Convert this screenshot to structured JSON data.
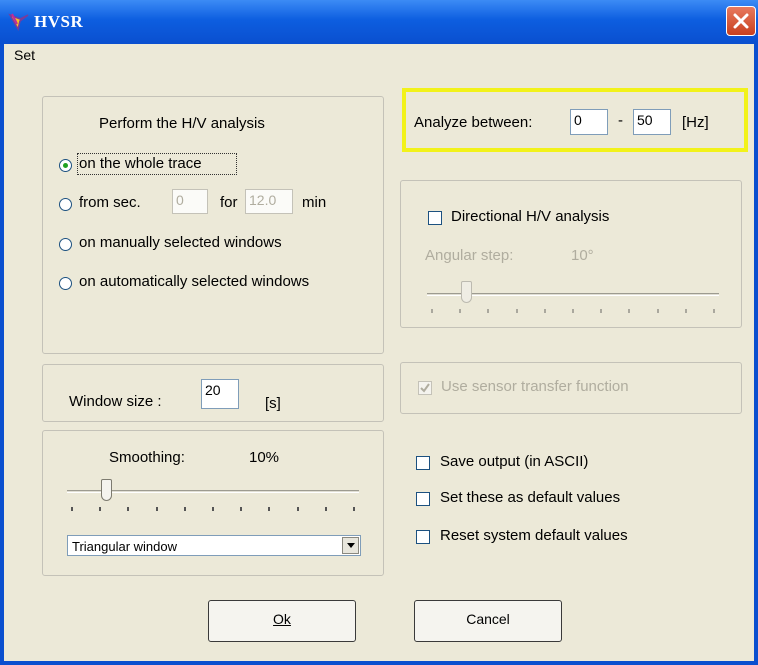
{
  "window": {
    "title": "HVSR",
    "menu": [
      "Set"
    ],
    "icon": "hvsr-logo-icon"
  },
  "analysis": {
    "title": "Perform the H/V analysis",
    "options": [
      {
        "label": "on the whole trace",
        "selected": true
      },
      {
        "label_before": "from sec.",
        "from_value": "0",
        "label_mid": "for",
        "for_value": "12.0",
        "label_after": "min",
        "selected": false
      },
      {
        "label": "on manually selected windows",
        "selected": false
      },
      {
        "label": "on automatically selected windows",
        "selected": false
      }
    ]
  },
  "range": {
    "label": "Analyze between:",
    "from": "0",
    "separator": "-",
    "to": "50",
    "unit": "[Hz]",
    "highlight_color": "#f2f21a"
  },
  "directional": {
    "checkbox_label": "Directional H/V analysis",
    "checked": false,
    "angular_label": "Angular step:",
    "angular_value": "10°",
    "slider_position": 0.12
  },
  "window_size": {
    "label": "Window size :",
    "value": "20",
    "unit": "[s]"
  },
  "sensor": {
    "label": "Use sensor transfer function",
    "checked": true,
    "enabled": false
  },
  "smoothing": {
    "label": "Smoothing:",
    "value": "10%",
    "slider_position": 0.12,
    "window_type": "Triangular window"
  },
  "options": [
    {
      "label": "Save output (in ASCII)",
      "checked": false
    },
    {
      "label": "Set these as default values",
      "checked": false
    },
    {
      "label": "Reset system default values",
      "checked": false
    }
  ],
  "buttons": {
    "ok": "Ok",
    "cancel": "Cancel"
  },
  "colors": {
    "titlebar": "#0a4fcf",
    "dialog_bg": "#ece9d8",
    "disabled_text": "#b0ad9f"
  }
}
